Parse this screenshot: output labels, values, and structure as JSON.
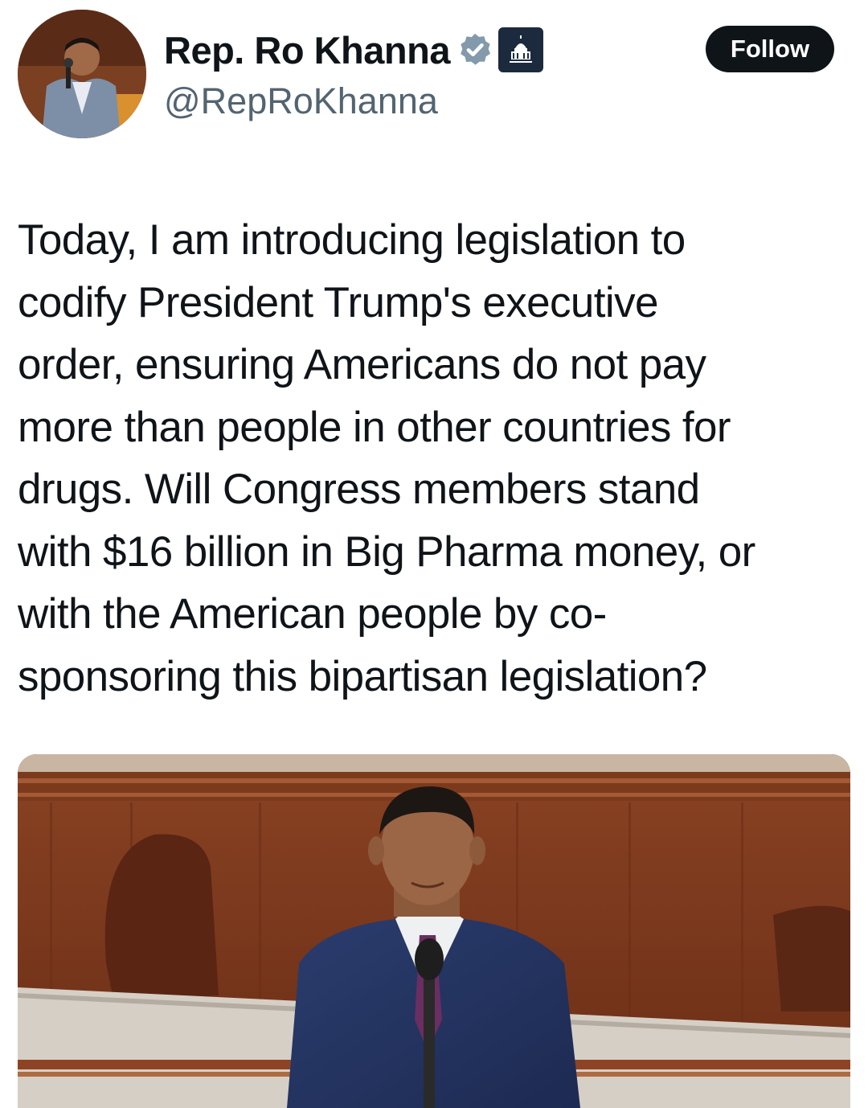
{
  "author": {
    "display_name": "Rep. Ro Khanna",
    "handle": "@RepRoKhanna",
    "verified_badge_icon": "verified-badge-icon",
    "affiliation_icon": "capitol-building-icon",
    "verified_color": "#829aab"
  },
  "follow_button": {
    "label": "Follow"
  },
  "tweet": {
    "text_lines": [
      "Today, I am introducing legislation to",
      "codify President Trump's executive",
      "order, ensuring Americans do not pay",
      "more than people in other countries for",
      "drugs. Will Congress members stand",
      "with $16 billion in Big Pharma money, or",
      "with the American people by co-",
      "sponsoring this bipartisan legislation?"
    ]
  },
  "colors": {
    "text_primary": "#0f1419",
    "text_secondary": "#536471",
    "button_bg": "#0f1419"
  }
}
